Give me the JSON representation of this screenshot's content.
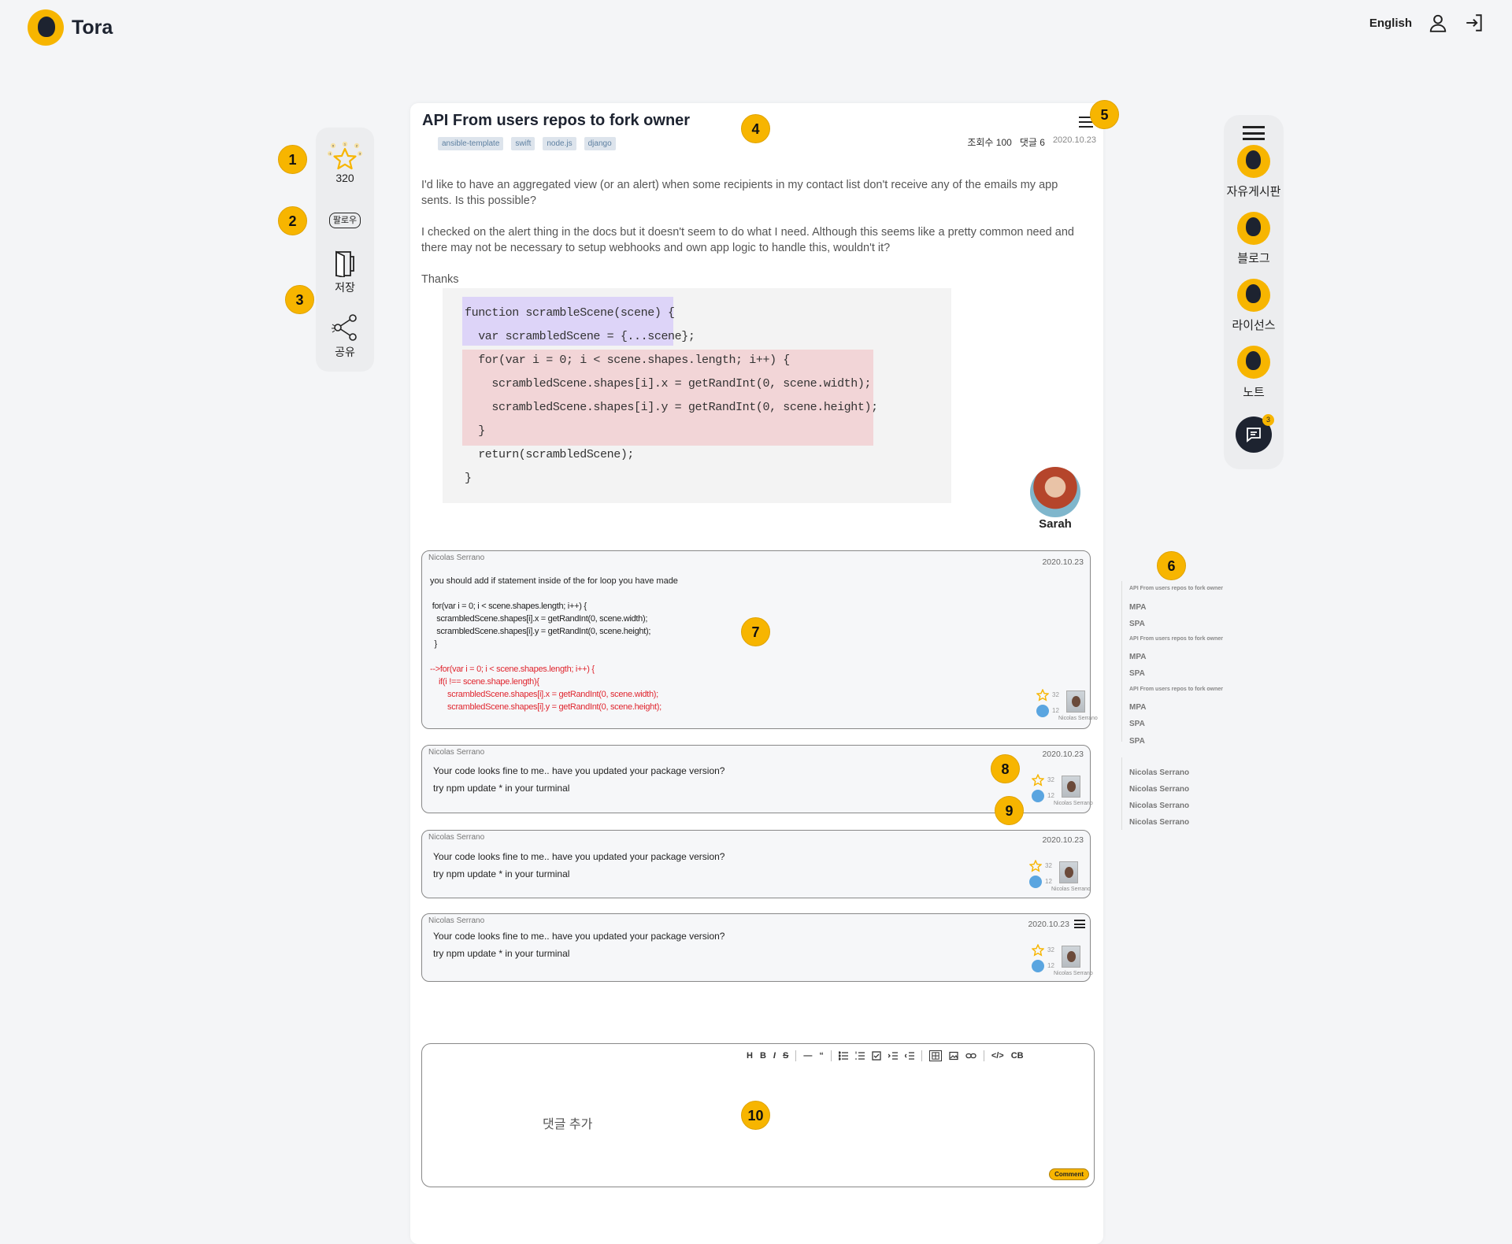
{
  "header": {
    "brand": "Tora",
    "language": "English",
    "profile_icon": "user-icon",
    "login_icon": "sign-in-icon"
  },
  "left_rail": {
    "star_count": "320",
    "star_ticks": [
      "0",
      "1",
      "2",
      "-1",
      "3"
    ],
    "follow_label": "팔로우",
    "save_label": "저장",
    "share_label": "공유"
  },
  "right_rail": {
    "menu_icon": "hamburger-icon",
    "nav": [
      {
        "label": "자유게시판"
      },
      {
        "label": "블로그"
      },
      {
        "label": "라이선스"
      },
      {
        "label": "노트"
      }
    ],
    "chat_badge": "3"
  },
  "post": {
    "title": "API From users repos to fork owner",
    "tags": [
      "ansible-template",
      "swift",
      "node.js",
      "django"
    ],
    "views_label": "조회수",
    "views": "100",
    "comments_label": "댓글",
    "comments": "6",
    "date": "2020.10.23",
    "paragraphs": [
      "I'd like to have an aggregated view (or an alert) when some recipients in my contact list don't receive any of the emails my app sents. Is this possible?",
      "I checked on the alert thing in the docs but it doesn't seem to do what I need. Although this seems like a pretty common need and there may not be necessary to setup webhooks and own app logic to handle this, wouldn't it?",
      "Thanks"
    ],
    "code_lines": [
      "function scrambleScene(scene) {",
      "  var scrambledScene = {...scene};",
      "  for(var i = 0; i < scene.shapes.length; i++) {",
      "    scrambledScene.shapes[i].x = getRandInt(0, scene.width);",
      "    scrambledScene.shapes[i].y = getRandInt(0, scene.height);",
      "  }",
      "  return(scrambledScene);",
      "}"
    ],
    "author": "Sarah"
  },
  "comments": [
    {
      "author": "Nicolas Serrano",
      "date": "2020.10.23",
      "intro": "you should add if statement inside of the for loop you have made",
      "code": [
        " for(var i = 0; i < scene.shapes.length; i++) {",
        "   scrambledScene.shapes[i].x = getRandInt(0, scene.width);",
        "   scrambledScene.shapes[i].y = getRandInt(0, scene.height);",
        "  }"
      ],
      "fix": [
        "-->for(var i = 0; i < scene.shapes.length; i++) {",
        "    if(i !== scene.shape.length){",
        "        scrambledScene.shapes[i].x = getRandInt(0, scene.width);",
        "        scrambledScene.shapes[i].y = getRandInt(0, scene.height);"
      ],
      "likes": "32",
      "replies": "12"
    },
    {
      "author": "Nicolas Serrano",
      "date": "2020.10.23",
      "lines": [
        "Your code looks fine to me.. have you updated your package version?",
        "try npm update * in your turminal"
      ],
      "likes": "32",
      "replies": "12"
    },
    {
      "author": "Nicolas Serrano",
      "date": "2020.10.23",
      "lines": [
        "Your code looks fine to me.. have you updated your package version?",
        "try npm update * in your turminal"
      ],
      "likes": "32",
      "replies": "12"
    },
    {
      "author": "Nicolas Serrano",
      "date": "2020.10.23",
      "lines": [
        "Your code looks fine to me.. have you updated your package version?",
        "try npm update * in your turminal"
      ],
      "likes": "32",
      "replies": "12"
    }
  ],
  "toc": [
    {
      "text": "API From users repos to fork owner",
      "kind": "section"
    },
    {
      "text": "MPA",
      "kind": "item"
    },
    {
      "text": "SPA",
      "kind": "item"
    },
    {
      "text": "API From users repos to fork owner",
      "kind": "section"
    },
    {
      "text": "MPA",
      "kind": "item"
    },
    {
      "text": "SPA",
      "kind": "item"
    },
    {
      "text": "API From users repos to fork owner",
      "kind": "section"
    },
    {
      "text": "MPA",
      "kind": "item"
    },
    {
      "text": "SPA",
      "kind": "item"
    },
    {
      "text": "SPA",
      "kind": "item"
    },
    {
      "text": "Nicolas Serrano",
      "kind": "item"
    },
    {
      "text": "Nicolas Serrano",
      "kind": "item"
    },
    {
      "text": "Nicolas Serrano",
      "kind": "item"
    },
    {
      "text": "Nicolas Serrano",
      "kind": "item"
    }
  ],
  "editor": {
    "toolbar": [
      "H",
      "B",
      "I",
      "S",
      "—",
      "“",
      "list",
      "olist",
      "task",
      "indent",
      "outdent",
      "table",
      "image",
      "link",
      "</>",
      "CB"
    ],
    "placeholder": "댓글 추가",
    "submit_label": "Comment"
  },
  "markers": [
    "1",
    "2",
    "3",
    "4",
    "5",
    "6",
    "7",
    "8",
    "9",
    "10"
  ],
  "colors": {
    "accent": "#f7b500",
    "dark": "#1d2330",
    "code_purple": "#ddd4f8",
    "code_red": "#f2d5d7",
    "error_red": "#e0262f"
  }
}
